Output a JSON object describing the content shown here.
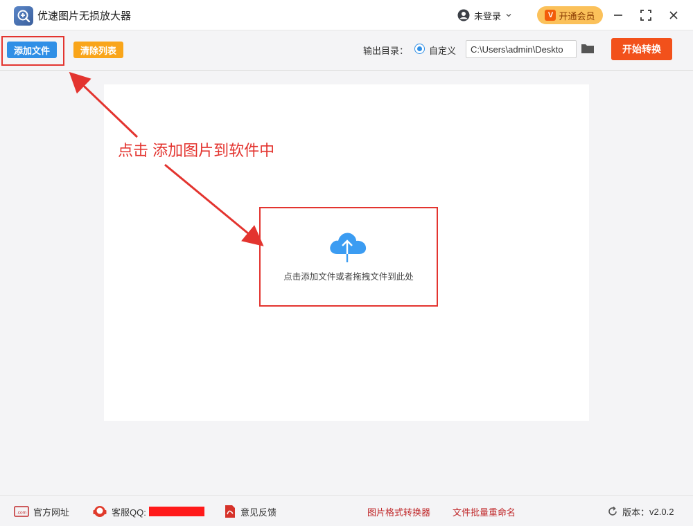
{
  "window": {
    "title": "优速图片无损放大器",
    "user_label": "未登录",
    "vip_label": "开通会员",
    "vip_badge": "V"
  },
  "toolbar": {
    "add_label": "添加文件",
    "clear_label": "清除列表",
    "output_label": "输出目录：",
    "custom_label": "自定义",
    "path_value": "C:\\Users\\admin\\Deskto",
    "start_label": "开始转换"
  },
  "main": {
    "drop_text": "点击添加文件或者拖拽文件到此处",
    "annotation": "点击 添加图片到软件中"
  },
  "footer": {
    "website": "官方网址",
    "qq": "客服QQ:",
    "feedback": "意见反馈",
    "format_converter": "图片格式转换器",
    "batch_rename": "文件批量重命名",
    "version_label": "版本：",
    "version": "v2.0.2",
    "com_text": ".com"
  },
  "colors": {
    "accent_blue": "#2f8fe6",
    "accent_orange": "#f9a51a",
    "start_red": "#f2511b",
    "annotation_red": "#e3342f",
    "vip_gold": "#fbc15a"
  }
}
